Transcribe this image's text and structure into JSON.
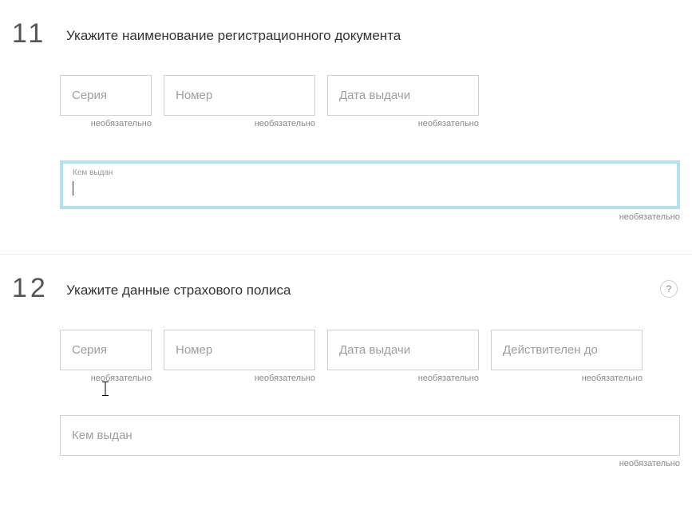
{
  "hints": {
    "optional": "необязательно"
  },
  "section11": {
    "number": "11",
    "title": "Укажите наименование регистрационного документа",
    "fields": {
      "series_placeholder": "Серия",
      "number_placeholder": "Номер",
      "issue_date_placeholder": "Дата выдачи",
      "issued_by_label": "Кем выдан",
      "issued_by_value": ""
    }
  },
  "section12": {
    "number": "12",
    "title": "Укажите данные страхового полиса",
    "help": "?",
    "fields": {
      "series_placeholder": "Серия",
      "number_placeholder": "Номер",
      "issue_date_placeholder": "Дата выдачи",
      "valid_until_placeholder": "Действителен до",
      "issued_by_placeholder": "Кем выдан"
    }
  }
}
